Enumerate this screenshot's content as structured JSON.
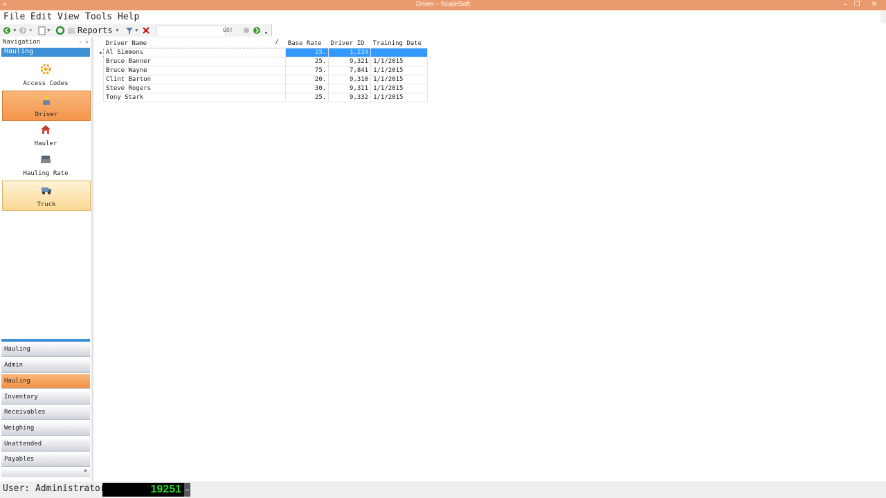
{
  "window": {
    "title": "Driver - ScaleSoft",
    "app_icon": "≈",
    "minimize": "‒",
    "restore": "❐",
    "close": "✕"
  },
  "menu": [
    "File",
    "Edit",
    "View",
    "Tools",
    "Help"
  ],
  "toolbar": {
    "reports_label": "Reports",
    "search_value": "",
    "go_label": "GO!",
    "colors": {
      "back": "#3a9a2a",
      "refresh": "#2f8f2f",
      "delete": "#cc1111"
    }
  },
  "navigation": {
    "header": "Navigation",
    "pin": "‹ ×",
    "group_title": "Hauling",
    "items": [
      {
        "label": "Access Codes",
        "icon": "gear-icon",
        "state": "normal"
      },
      {
        "label": "Driver",
        "icon": "driver-icon",
        "state": "selected"
      },
      {
        "label": "Hauler",
        "icon": "house-icon",
        "state": "normal"
      },
      {
        "label": "Hauling Rate",
        "icon": "cash-register-icon",
        "state": "normal"
      },
      {
        "label": "Truck",
        "icon": "truck-icon",
        "state": "hover"
      }
    ],
    "groups": [
      "Hauling",
      "Admin",
      "Hauling",
      "Inventory",
      "Receivables",
      "Weighing",
      "Unattended",
      "Payables"
    ],
    "active_group_index": 2,
    "footer_chevron": "»"
  },
  "grid": {
    "columns": [
      "Driver Name",
      "Base Rate",
      "Driver ID",
      "Training Date"
    ],
    "sort_indicator": "/",
    "rows": [
      {
        "name": "Al Simmons",
        "base_rate": "15.",
        "driver_id": "1,234",
        "training_date": "",
        "selected": true
      },
      {
        "name": "Bruce Banner",
        "base_rate": "25.",
        "driver_id": "9,321",
        "training_date": "1/1/2015"
      },
      {
        "name": "Bruce Wayne",
        "base_rate": "75.",
        "driver_id": "7,841",
        "training_date": "1/1/2015"
      },
      {
        "name": "Clint Barton",
        "base_rate": "20.",
        "driver_id": "9,310",
        "training_date": "1/1/2015"
      },
      {
        "name": "Steve Rogers",
        "base_rate": "30.",
        "driver_id": "9,311",
        "training_date": "1/1/2015"
      },
      {
        "name": "Tony Stark",
        "base_rate": "25.",
        "driver_id": "9,332",
        "training_date": "1/1/2015"
      }
    ]
  },
  "status": {
    "user": "User: Administrator",
    "counter": "19251",
    "counter_btn": "…"
  }
}
